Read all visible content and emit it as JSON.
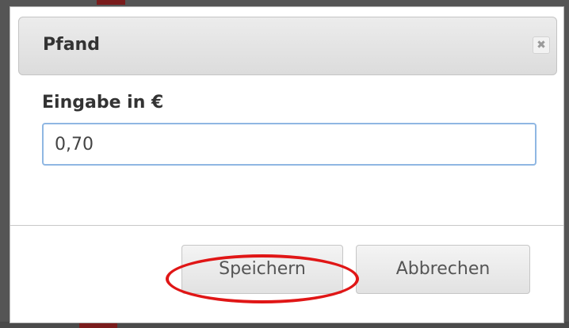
{
  "dialog": {
    "title": "Pfand",
    "close_symbol": "✖"
  },
  "form": {
    "field_label": "Eingabe in €",
    "input_value": "0,70"
  },
  "buttons": {
    "save_label": "Speichern",
    "cancel_label": "Abbrechen"
  },
  "annotation": {
    "highlight_color": "#e01616"
  }
}
